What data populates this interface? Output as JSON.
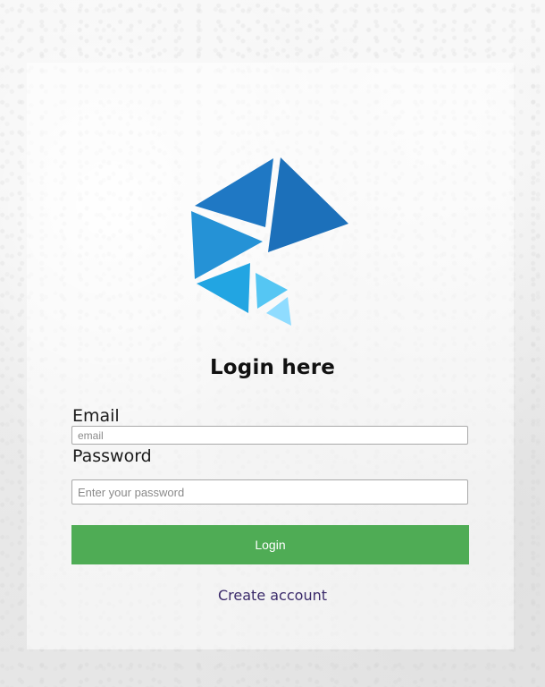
{
  "login": {
    "title": "Login here",
    "email_label": "Email",
    "email_placeholder": "email",
    "email_value": "",
    "password_label": "Password",
    "password_placeholder": "Enter your password",
    "password_value": "",
    "login_button": "Login",
    "create_account": "Create account"
  },
  "logo": {
    "icon": "geometric-triangles-logo"
  },
  "colors": {
    "primary_button": "#4fac55",
    "link": "#3a2a6a",
    "logo_dark_blue": "#1f78c4",
    "logo_mid_blue": "#2196dc",
    "logo_light_blue": "#5ac8f5",
    "logo_pale_blue": "#8fdcff"
  }
}
